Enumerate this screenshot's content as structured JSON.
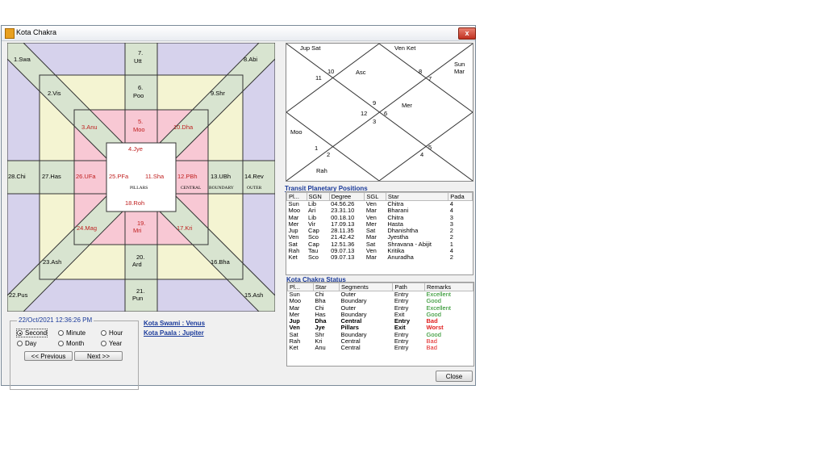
{
  "window": {
    "title": "Kota Chakra",
    "close_glyph": "x"
  },
  "kota": {
    "cells": {
      "c1": "1.Swa",
      "c2": "2.Vis",
      "c3": "3.Anu",
      "c4": "4.Jye",
      "c5a": "5.",
      "c5b": "Moo",
      "c6a": "6.",
      "c6b": "Poo",
      "c7a": "7.",
      "c7b": "Utt",
      "c8": "8.Abi",
      "c9": "9.Shr",
      "c10": "10.Dha",
      "c11": "11.Sha",
      "c12": "12.PBh",
      "c13": "13.UBh",
      "c14": "14.Rev",
      "c15": "15.Ash",
      "c16": "16.Bha",
      "c17": "17.Kri",
      "c18": "18.Roh",
      "c19a": "19.",
      "c19b": "Mri",
      "c20a": "20.",
      "c20b": "Ard",
      "c21a": "21.",
      "c21b": "Pun",
      "c22": "22.Pus",
      "c23": "23.Ash",
      "c24": "24.Mag",
      "c25": "25.PFa",
      "c26": "26.UFa",
      "c27": "27.Has",
      "c28": "28.Chi"
    },
    "labels": {
      "pillars": "PILLARS",
      "central": "CENTRAL",
      "boundary": "BOUNDARY",
      "outer": "OUTER"
    }
  },
  "chart": {
    "houses": {
      "h1": "1",
      "h2": "2",
      "h3": "3",
      "h4": "4",
      "h5": "5",
      "h6": "6",
      "h7": "7",
      "h8": "8",
      "h9": "9",
      "h10": "10",
      "h11": "11",
      "h12": "12"
    },
    "planets": {
      "jupsat": "Jup Sat",
      "venket": "Ven Ket",
      "sun": "Sun",
      "mar": "Mar",
      "asc": "Asc",
      "mer": "Mer",
      "moo": "Moo",
      "rah": "Rah"
    }
  },
  "transit": {
    "title": "Transit Planetary Positions",
    "headers": [
      "Pl...",
      "SGN",
      "Degree",
      "SGL",
      "Star",
      "Pada"
    ],
    "rows": [
      [
        "Sun",
        "Lib",
        "04.56.26",
        "Ven",
        "Chitra",
        "4"
      ],
      [
        "Moo",
        "Ari",
        "23.31.10",
        "Mar",
        "Bharani",
        "4"
      ],
      [
        "Mar",
        "Lib",
        "00.18.10",
        "Ven",
        "Chitra",
        "3"
      ],
      [
        "Mer",
        "Vir",
        "17.09.13",
        "Mer",
        "Hasta",
        "3"
      ],
      [
        "Jup",
        "Cap",
        "28.11.35",
        "Sat",
        "Dhanishtha",
        "2"
      ],
      [
        "Ven",
        "Sco",
        "21.42.42",
        "Mar",
        "Jyestha",
        "2"
      ],
      [
        "Sat",
        "Cap",
        "12.51.36",
        "Sat",
        "Shravana - Abijit",
        "1"
      ],
      [
        "Rah",
        "Tau",
        "09.07.13",
        "Ven",
        "Kritika",
        "4"
      ],
      [
        "Ket",
        "Sco",
        "09.07.13",
        "Mar",
        "Anuradha",
        "2"
      ]
    ]
  },
  "status": {
    "title": "Kota Chakra Status",
    "headers": [
      "Pl...",
      "Star",
      "Segments",
      "Path",
      "Remarks"
    ],
    "rows": [
      [
        "Sun",
        "Chi",
        "Outer",
        "Entry",
        "Excellent"
      ],
      [
        "Moo",
        "Bha",
        "Boundary",
        "Entry",
        "Good"
      ],
      [
        "Mar",
        "Chi",
        "Outer",
        "Entry",
        "Excellent"
      ],
      [
        "Mer",
        "Has",
        "Boundary",
        "Exit",
        "Good"
      ],
      [
        "Jup",
        "Dha",
        "Central",
        "Entry",
        "Bad"
      ],
      [
        "Ven",
        "Jye",
        "Pillars",
        "Exit",
        "Worst"
      ],
      [
        "Sat",
        "Shr",
        "Boundary",
        "Entry",
        "Good"
      ],
      [
        "Rah",
        "Kri",
        "Central",
        "Entry",
        "Bad"
      ],
      [
        "Ket",
        "Anu",
        "Central",
        "Entry",
        "Bad"
      ]
    ]
  },
  "controls": {
    "datetime": "22/Oct/2021 12:36:26 PM",
    "second": "Second",
    "minute": "Minute",
    "hour": "Hour",
    "day": "Day",
    "month": "Month",
    "year": "Year",
    "previous": "<<  Previous",
    "next": "Next >>"
  },
  "info": {
    "swami": "Kota Swami : Venus",
    "paala": "Kota Paala : Jupiter"
  },
  "close_label": "Close",
  "colors": {
    "purple": "#d6d2ec",
    "green": "#d8e4d0",
    "yellow": "#f4f4d2",
    "pink": "#f8c8d4",
    "red_text": "#c02020",
    "good": "#1a8a1a",
    "bad": "#e02020"
  }
}
